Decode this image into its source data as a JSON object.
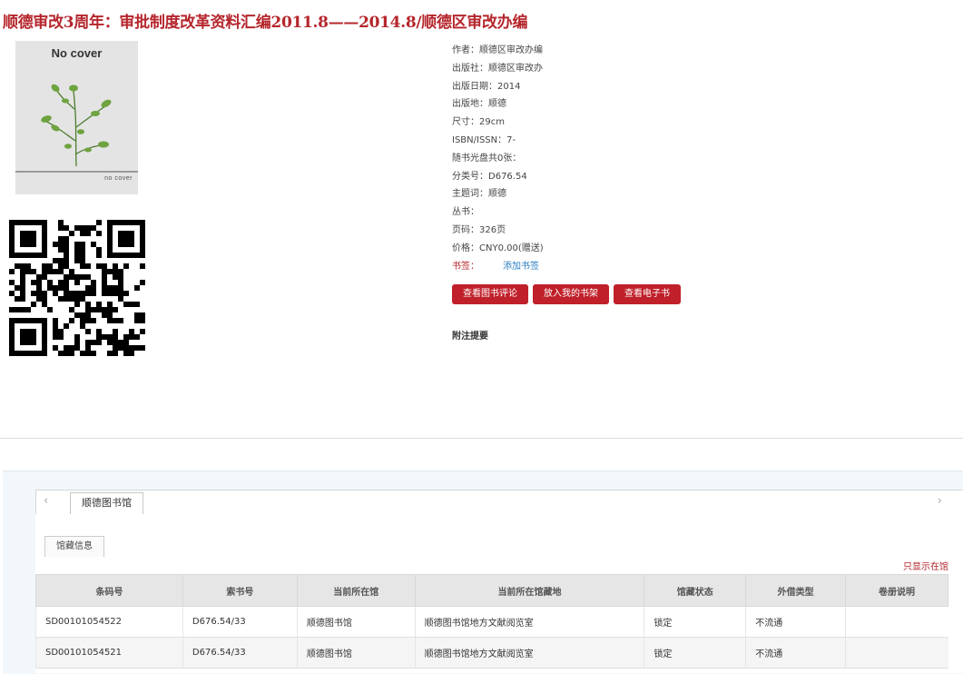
{
  "book": {
    "title": "顺德审改3周年：审批制度改革资料汇编2011.8——2014.8/顺德区审改办编",
    "cover": {
      "top_text": "No cover",
      "bottom_text": "no cover"
    }
  },
  "meta": [
    {
      "key": "作者：",
      "value": "顺德区审改办编"
    },
    {
      "key": "出版社：",
      "value": "顺德区审改办"
    },
    {
      "key": "出版日期：",
      "value": "2014"
    },
    {
      "key": "出版地：",
      "value": "顺德"
    },
    {
      "key": "尺寸：",
      "value": "29cm"
    },
    {
      "key": "ISBN/ISSN：",
      "value": "7-"
    },
    {
      "key": "随书光盘共0张：",
      "value": ""
    },
    {
      "key": "分类号：",
      "value": "D676.54"
    },
    {
      "key": "主题词：",
      "value": "顺德"
    },
    {
      "key": "丛书：",
      "value": ""
    },
    {
      "key": "页码：",
      "value": "326页"
    },
    {
      "key": "价格：",
      "value": "CNY0.00(赠送)"
    }
  ],
  "bookmark": {
    "label": "书签：",
    "link": "添加书签"
  },
  "buttons": {
    "review": "查看图书评论",
    "shelf": "放入我的书架",
    "ebook": "查看电子书"
  },
  "notes_label": "附注提要",
  "library_tabs": {
    "active": "顺德图书馆",
    "prev_icon": "‹",
    "next_icon": "›"
  },
  "holdings": {
    "subtab": "馆藏信息",
    "only_show": "只显示在馆",
    "columns": [
      "条码号",
      "索书号",
      "当前所在馆",
      "当前所在馆藏地",
      "馆藏状态",
      "外借类型",
      "卷册说明"
    ],
    "rows": [
      [
        "SD00101054522",
        "D676.54/33",
        "顺德图书馆",
        "顺德图书馆地方文献阅览室",
        "锁定",
        "不流通",
        ""
      ],
      [
        "SD00101054521",
        "D676.54/33",
        "顺德图书馆",
        "顺德图书馆地方文献阅览室",
        "锁定",
        "不流通",
        ""
      ]
    ]
  },
  "colors": {
    "accent": "#c0202a",
    "title": "#b5262c",
    "link": "#2a7ec1"
  }
}
